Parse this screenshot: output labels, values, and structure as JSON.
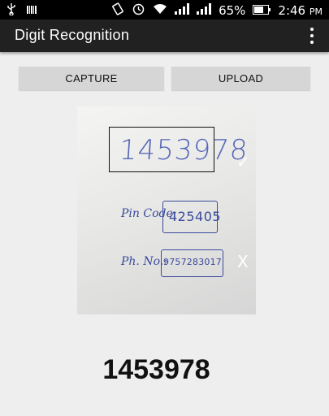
{
  "status_bar": {
    "battery_percent": "65%",
    "time": "2:46",
    "time_suffix": "PM",
    "icons": [
      "usb-icon",
      "barcode-icon",
      "rotate-icon",
      "alarm-icon",
      "wifi-icon",
      "signal-icon",
      "signal-icon",
      "battery-icon"
    ]
  },
  "app_bar": {
    "title": "Digit Recognition",
    "menu_icon": "overflow-menu-icon"
  },
  "buttons": {
    "capture": "CAPTURE",
    "upload": "UPLOAD"
  },
  "photo": {
    "handwritten_number": "1453978",
    "pin_label": "Pin Code:",
    "pin_value": "425405",
    "phone_label": "Ph. No.:",
    "phone_value": "9757283017",
    "check_mark": "✓",
    "cross_mark": "X"
  },
  "result": {
    "recognized_digits": "1453978"
  }
}
